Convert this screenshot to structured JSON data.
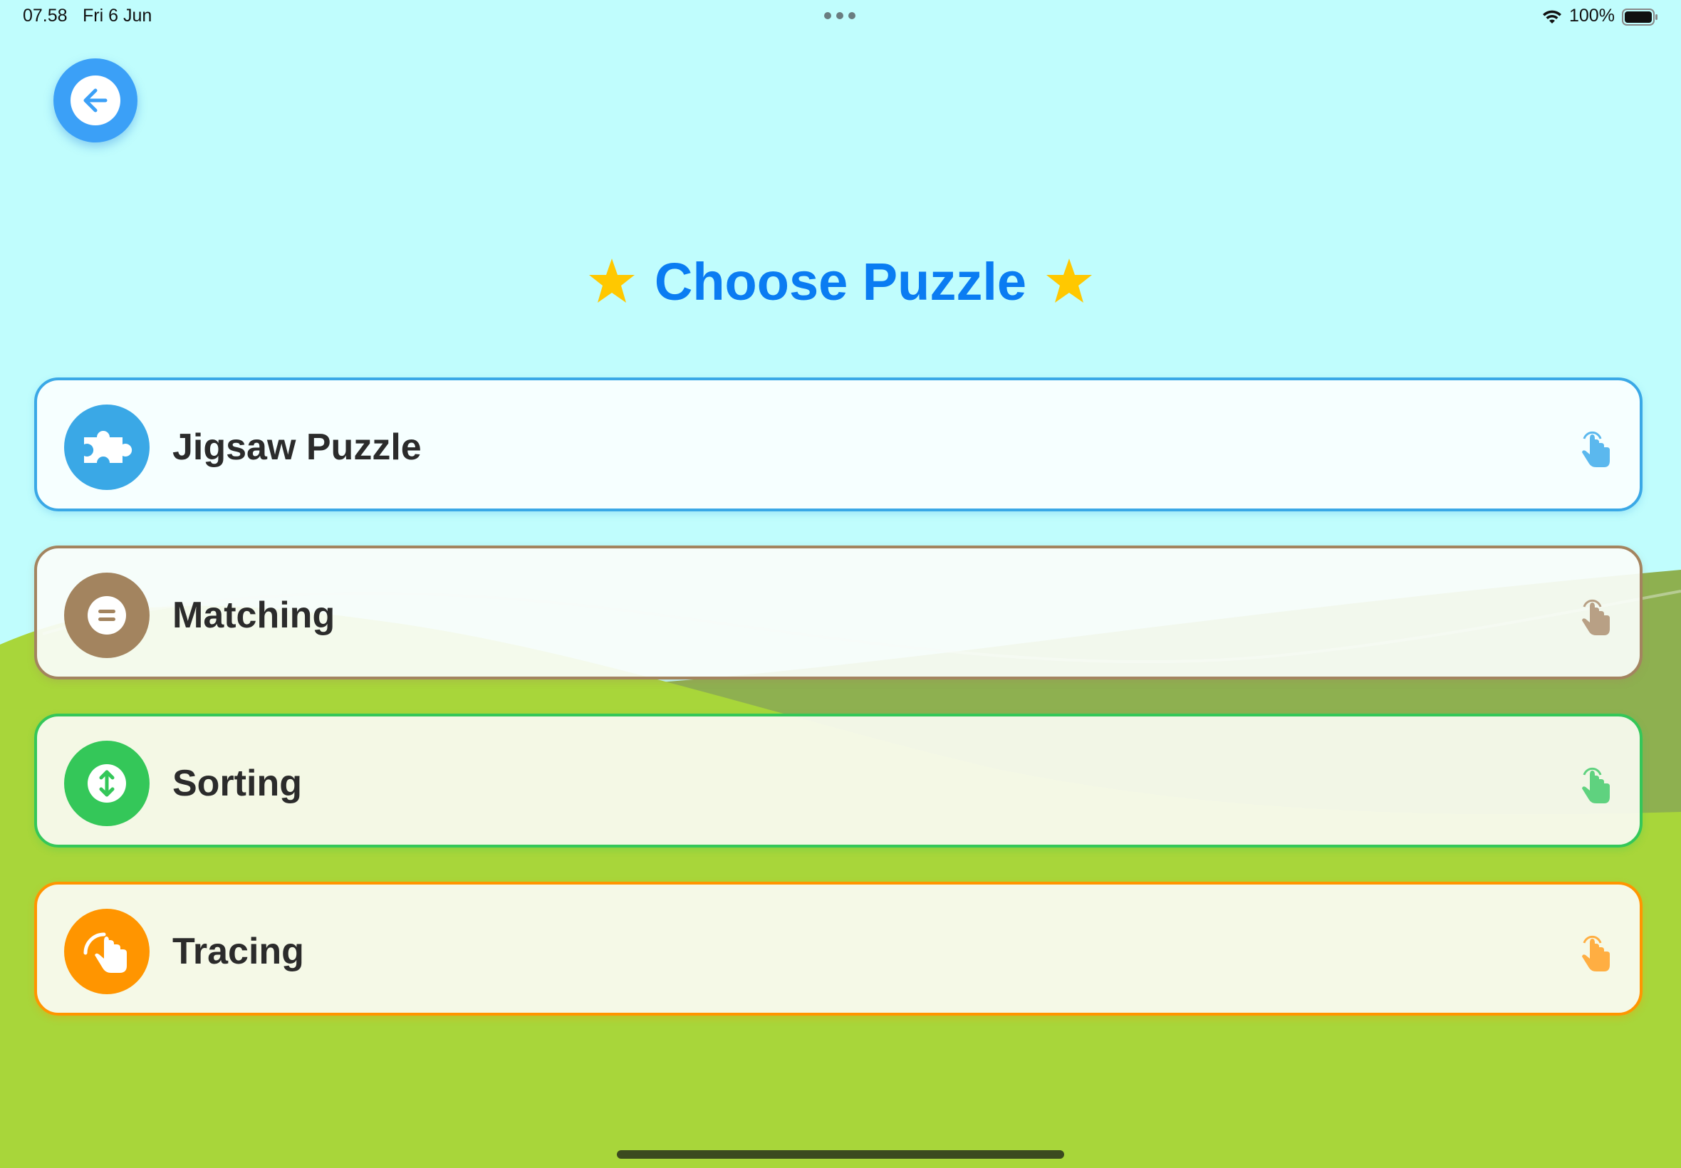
{
  "status_bar": {
    "time": "07.58",
    "date": "Fri 6 Jun",
    "battery": "100%"
  },
  "header": {
    "back_icon": "arrow-left-icon",
    "title": "Choose Puzzle",
    "title_decoration_icon": "star-icon"
  },
  "puzzles": [
    {
      "label": "Jigsaw Puzzle",
      "icon": "puzzle-piece-icon",
      "color": "#3aa8e6"
    },
    {
      "label": "Matching",
      "icon": "equals-icon",
      "color": "#a3845f"
    },
    {
      "label": "Sorting",
      "icon": "up-down-arrow-icon",
      "color": "#34c759"
    },
    {
      "label": "Tracing",
      "icon": "hand-tap-icon",
      "color": "#ff9500"
    }
  ],
  "colors": {
    "sky": "#c0fdfd",
    "grass": "#a8d63a",
    "title": "#0a7cf2",
    "star": "#ffc800"
  }
}
